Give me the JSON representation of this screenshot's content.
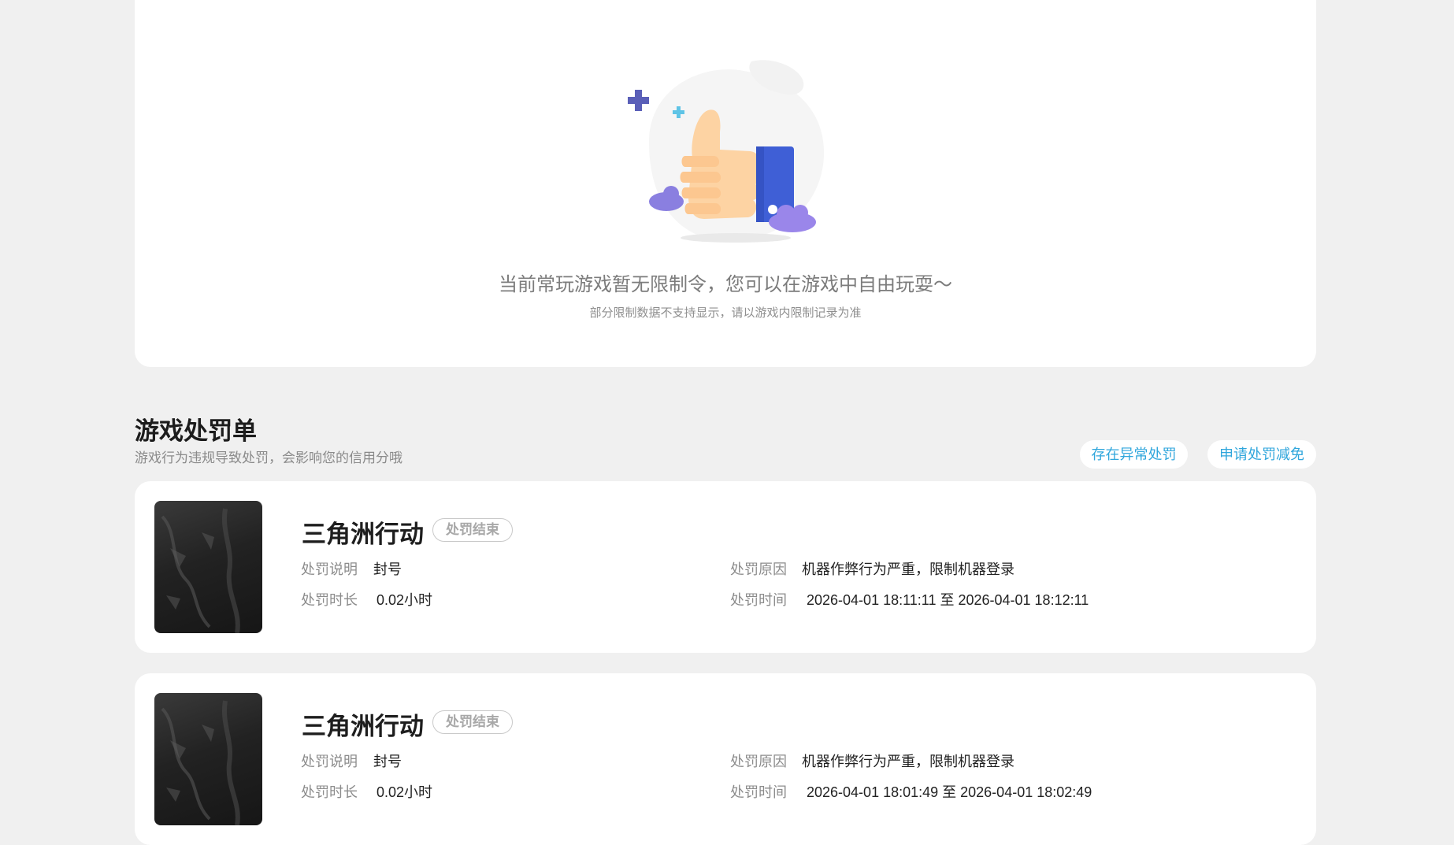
{
  "empty_state": {
    "title": "当前常玩游戏暂无限制令，您可以在游戏中自由玩耍～",
    "subtitle": "部分限制数据不支持显示，请以游戏内限制记录为准",
    "illustration_icon": "thumbs-up-icon"
  },
  "section": {
    "title": "游戏处罚单",
    "subtitle": "游戏行为违规导致处罚，会影响您的信用分哦"
  },
  "actions": {
    "abnormal_label": "存在异常处罚",
    "reduce_label": "申请处罚减免"
  },
  "records": [
    {
      "game": "三角洲行动",
      "status": "处罚结束",
      "desc_label": "处罚说明",
      "desc_value": "封号",
      "duration_label": "处罚时长",
      "duration_value": "0.02小时",
      "reason_label": "处罚原因",
      "reason_value": "机器作弊行为严重，限制机器登录",
      "time_label": "处罚时间",
      "time_value": "2026-04-01 18:11:11 至 2026-04-01 18:12:11"
    },
    {
      "game": "三角洲行动",
      "status": "处罚结束",
      "desc_label": "处罚说明",
      "desc_value": "封号",
      "duration_label": "处罚时长",
      "duration_value": "0.02小时",
      "reason_label": "处罚原因",
      "reason_value": "机器作弊行为严重，限制机器登录",
      "time_label": "处罚时间",
      "time_value": "2026-04-01 18:01:49 至 2026-04-01 18:02:49"
    }
  ],
  "colors": {
    "background": "#f0f0f0",
    "card": "#ffffff",
    "accent": "#2fa6dc",
    "badge_border": "#c9c9c9"
  }
}
